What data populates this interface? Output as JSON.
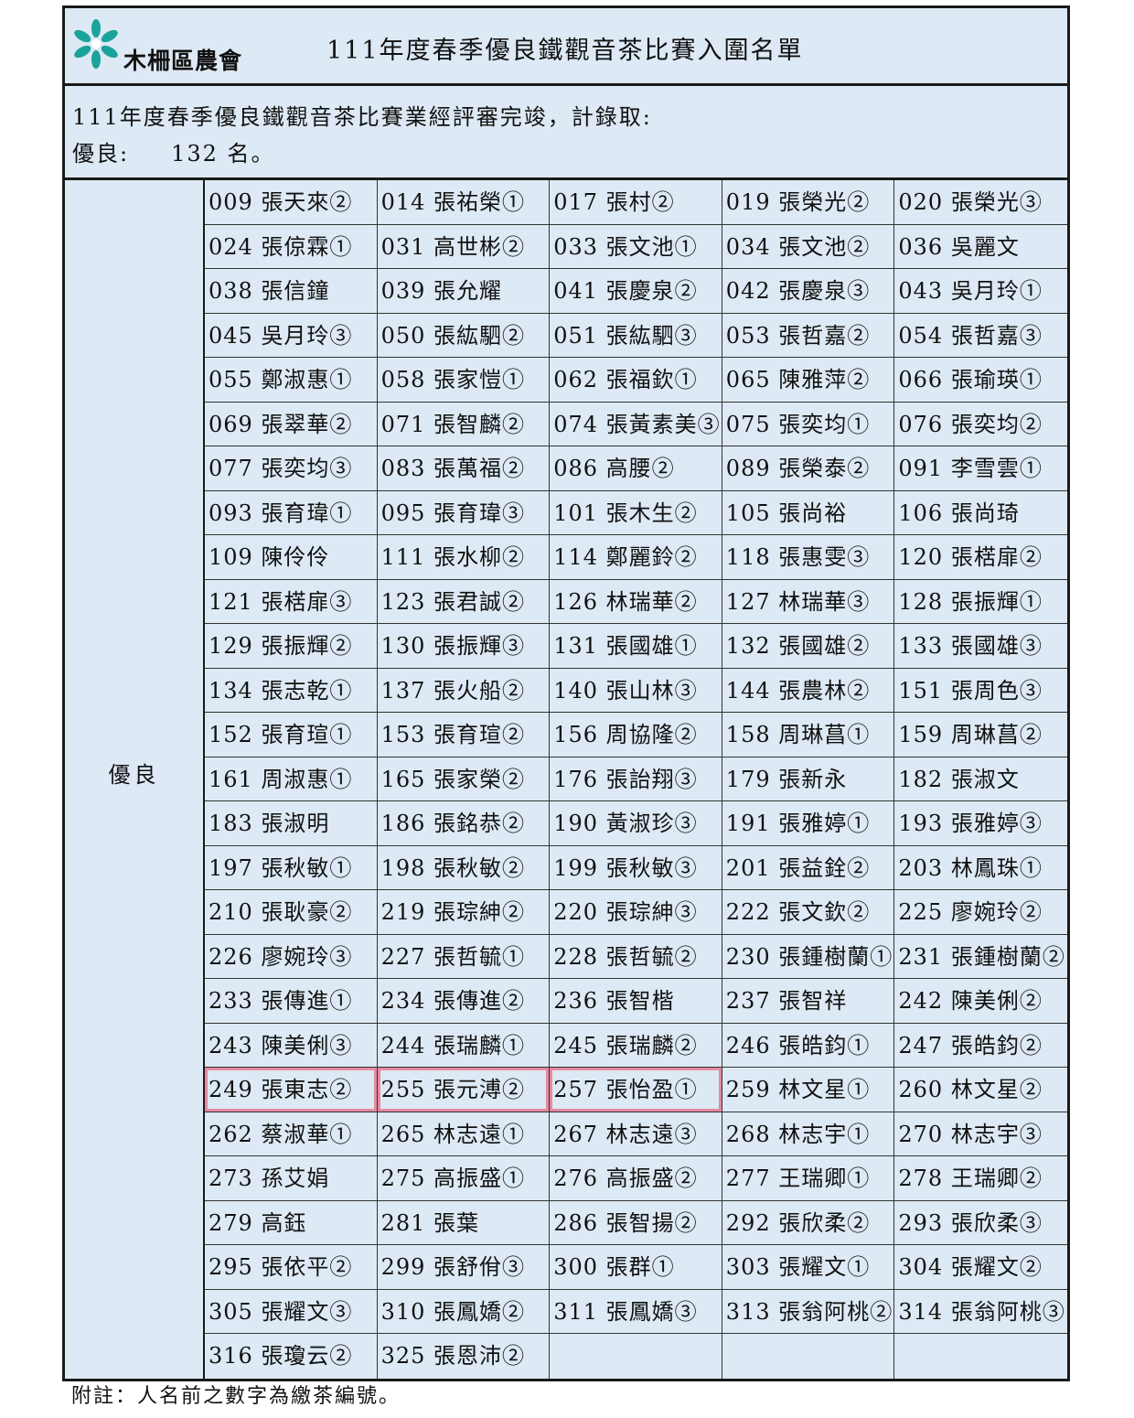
{
  "header": {
    "org_name": "木柵區農會",
    "title": "111年度春季優良鐵觀音茶比賽入圍名單"
  },
  "intro": {
    "line1": "111年度春季優良鐵觀音茶比賽業經評審完竣，計錄取:",
    "count_label": "優良:",
    "count_value": "132 名。"
  },
  "category": "優良",
  "entries": [
    "009 張天來②",
    "014 張祐榮①",
    "017 張村②",
    "019 張榮光②",
    "020 張榮光③",
    "024 張倞霖①",
    "031 高世彬②",
    "033 張文池①",
    "034 張文池②",
    "036 吳麗文",
    "038 張信鐘",
    "039 張允耀",
    "041 張慶泉②",
    "042 張慶泉③",
    "043 吳月玲①",
    "045 吳月玲③",
    "050 張紘駟②",
    "051 張紘駟③",
    "053 張哲嘉②",
    "054 張哲嘉③",
    "055 鄭淑惠①",
    "058 張家愷①",
    "062 張福欽①",
    "065 陳雅萍②",
    "066 張瑜瑛①",
    "069 張翠華②",
    "071 張智麟②",
    "074 張黃素美③",
    "075 張奕均①",
    "076 張奕均②",
    "077 張奕均③",
    "083 張萬福②",
    "086 高腰②",
    "089 張榮泰②",
    "091 李雪雲①",
    "093 張育瑋①",
    "095 張育瑋③",
    "101 張木生②",
    "105 張尚裕",
    "106 張尚琦",
    "109 陳伶伶",
    "111 張水柳②",
    "114 鄭麗鈴②",
    "118 張惠雯③",
    "120 張楛扉②",
    "121 張楛扉③",
    "123 張君誠②",
    "126 林瑞華②",
    "127 林瑞華③",
    "128 張振輝①",
    "129 張振輝②",
    "130 張振輝③",
    "131 張國雄①",
    "132 張國雄②",
    "133 張國雄③",
    "134 張志乾①",
    "137 張火船②",
    "140 張山林③",
    "144 張農林②",
    "151 張周色③",
    "152 張育瑄①",
    "153 張育瑄②",
    "156 周協隆②",
    "158 周琳菖①",
    "159 周琳菖②",
    "161 周淑惠①",
    "165 張家榮②",
    "176 張詒翔③",
    "179 張新永",
    "182 張淑文",
    "183 張淑明",
    "186 張銘恭②",
    "190 黃淑珍③",
    "191 張雅婷①",
    "193 張雅婷③",
    "197 張秋敏①",
    "198 張秋敏②",
    "199 張秋敏③",
    "201 張益銓②",
    "203 林鳳珠①",
    "210 張耿豪②",
    "219 張琮紳②",
    "220 張琮紳③",
    "222 張文欽②",
    "225 廖婉玲②",
    "226 廖婉玲③",
    "227 張哲毓①",
    "228 張哲毓②",
    "230 張鍾樹蘭①",
    "231 張鍾樹蘭②",
    "233 張傳進①",
    "234 張傳進②",
    "236 張智楷",
    "237 張智祥",
    "242 陳美俐②",
    "243 陳美俐③",
    "244 張瑞麟①",
    "245 張瑞麟②",
    "246 張皓鈞①",
    "247 張皓鈞②",
    "249 張東志②",
    "255 張元溥②",
    "257 張怡盈①",
    "259 林文星①",
    "260 林文星②",
    "262 蔡淑華①",
    "265 林志遠①",
    "267 林志遠③",
    "268 林志宇①",
    "270 林志宇③",
    "273 孫艾娟",
    "275 高振盛①",
    "276 高振盛②",
    "277 王瑞卿①",
    "278 王瑞卿②",
    "279 高鈺",
    "281 張葉",
    "286 張智揚②",
    "292 張欣柔②",
    "293 張欣柔③",
    "295 張依平②",
    "299 張舒佾③",
    "300 張群①",
    "303 張耀文①",
    "304 張耀文②",
    "305 張耀文③",
    "310 張鳳嬌②",
    "311 張鳳嬌③",
    "313 張翁阿桃②",
    "314 張翁阿桃③",
    "316 張瓊云②",
    "325 張恩沛②",
    "",
    "",
    ""
  ],
  "highlighted_indices": [
    100,
    101,
    102
  ],
  "highlight_color": "#e85878",
  "footnote": "附註：人名前之數字為繳茶編號。"
}
